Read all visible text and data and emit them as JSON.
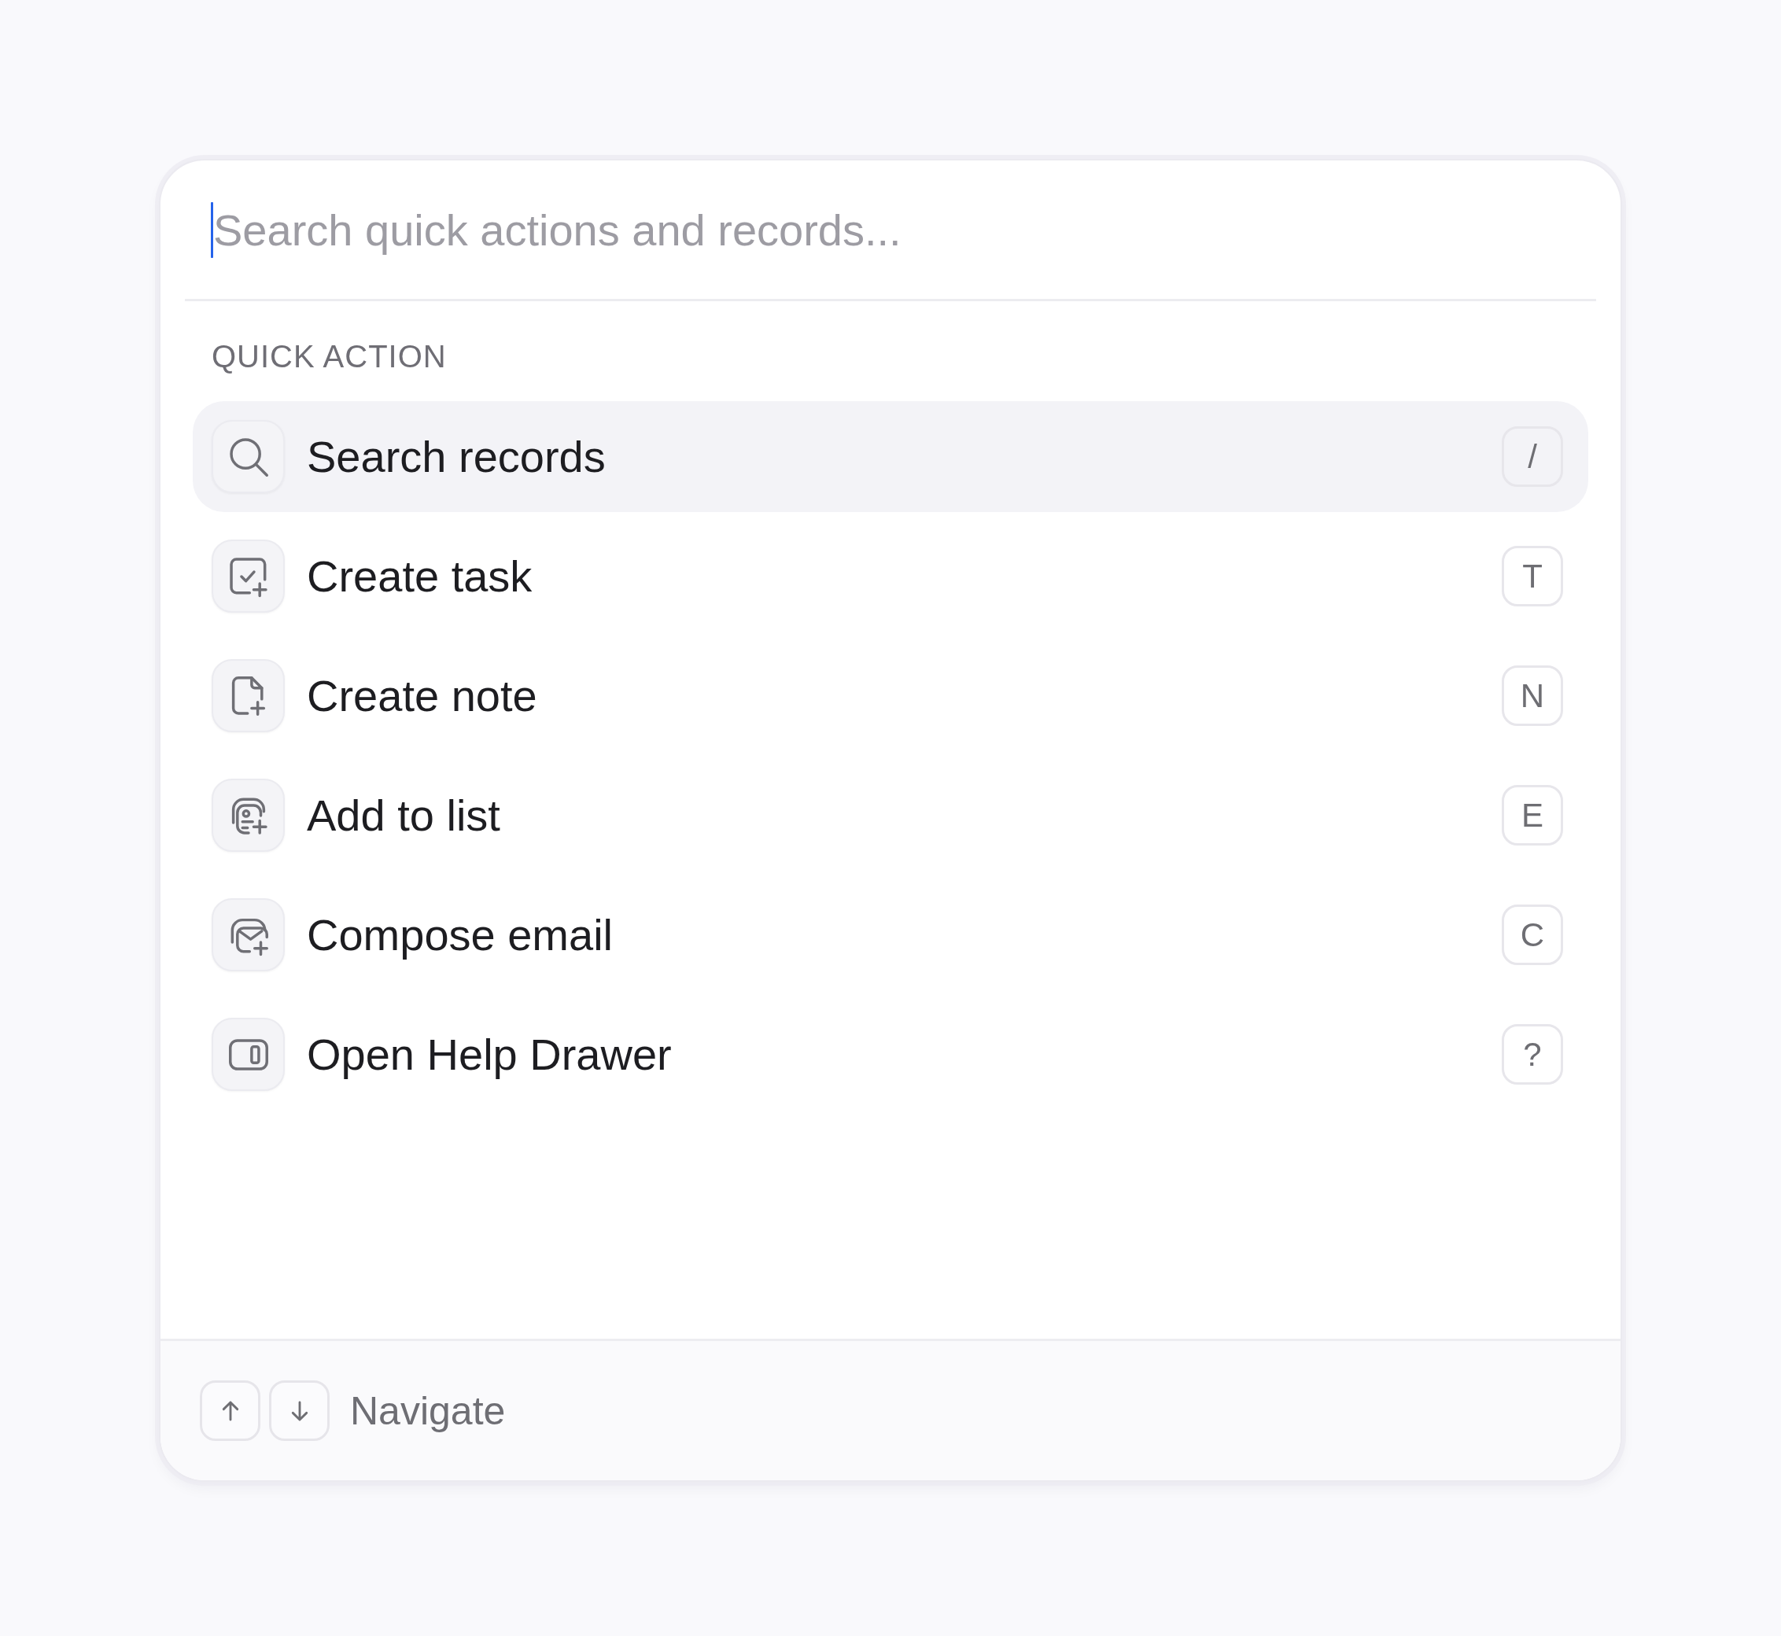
{
  "search": {
    "placeholder": "Search quick actions and records...",
    "focused": true
  },
  "quick_actions": {
    "heading": "QUICK ACTION",
    "items": [
      {
        "label": "Search records",
        "kind": "search",
        "shortcut": "/",
        "selected": true
      },
      {
        "label": "Create task",
        "kind": "task",
        "shortcut": "T",
        "selected": false
      },
      {
        "label": "Create note",
        "kind": "note",
        "shortcut": "N",
        "selected": false
      },
      {
        "label": "Add to list",
        "kind": "list",
        "shortcut": "E",
        "selected": false
      },
      {
        "label": "Compose email",
        "kind": "email",
        "shortcut": "C",
        "selected": false
      },
      {
        "label": "Open Help Drawer",
        "kind": "drawer",
        "shortcut": "?",
        "selected": false
      }
    ]
  },
  "footer": {
    "keys": [
      {
        "kind": "up"
      },
      {
        "kind": "down"
      }
    ],
    "hint": "Navigate"
  }
}
